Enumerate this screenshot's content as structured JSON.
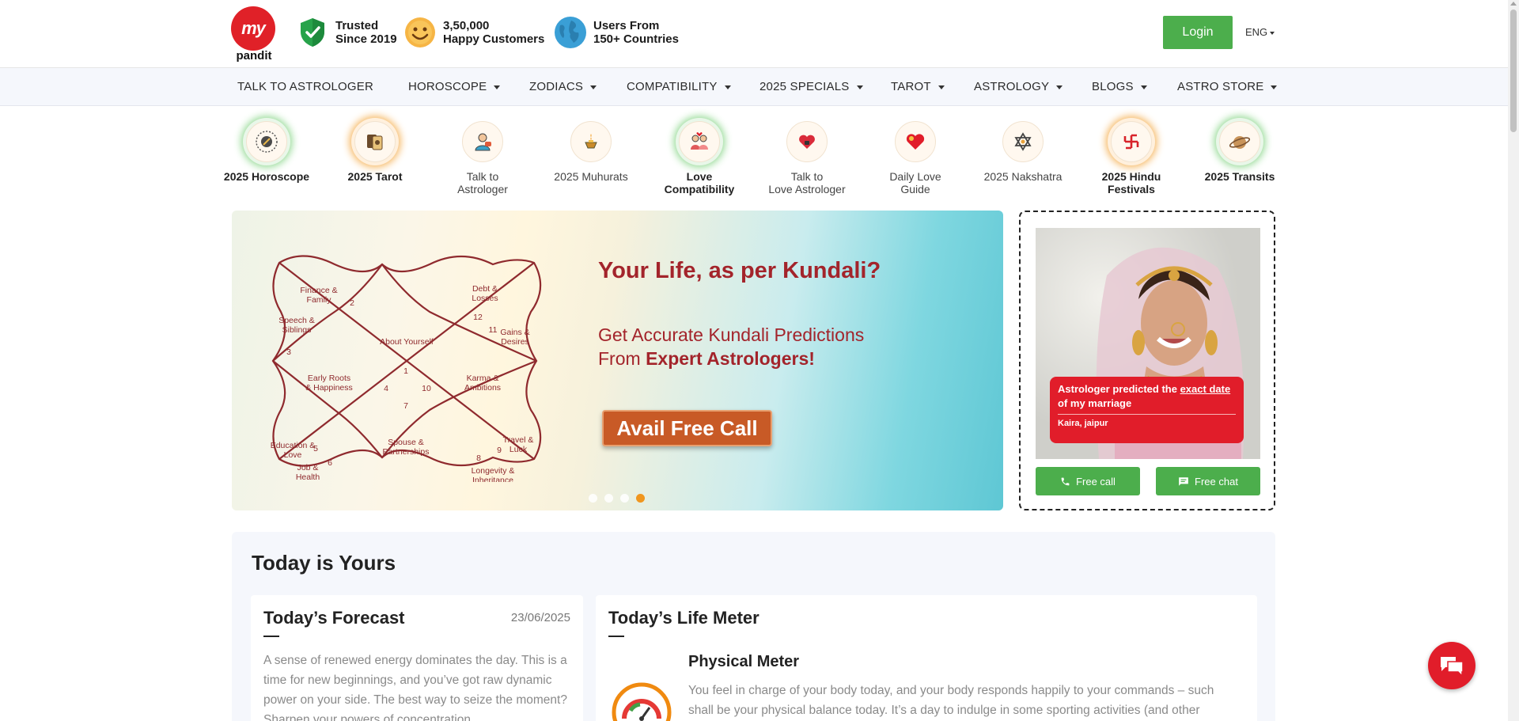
{
  "header": {
    "logo_my": "my",
    "logo_text": "pandit",
    "trust_items": [
      {
        "icon": "shield-check-icon",
        "line1": "Trusted",
        "line2": "Since 2019"
      },
      {
        "icon": "smiley-icon",
        "line1": "3,50,000",
        "line2": "Happy Customers"
      },
      {
        "icon": "globe-icon",
        "line1": "Users From",
        "line2": "150+ Countries"
      }
    ],
    "login_label": "Login",
    "language": "ENG"
  },
  "nav": {
    "items": [
      {
        "label": "TALK TO ASTROLOGER",
        "dropdown": false
      },
      {
        "label": "HOROSCOPE",
        "dropdown": true
      },
      {
        "label": "ZODIACS",
        "dropdown": true
      },
      {
        "label": "COMPATIBILITY",
        "dropdown": true
      },
      {
        "label": "2025 SPECIALS",
        "dropdown": true
      },
      {
        "label": "TAROT",
        "dropdown": true
      },
      {
        "label": "ASTROLOGY",
        "dropdown": true
      },
      {
        "label": "BLOGS",
        "dropdown": true
      },
      {
        "label": "ASTRO STORE",
        "dropdown": true
      }
    ]
  },
  "quick_links": [
    {
      "label": "2025 Horoscope",
      "icon": "horoscope-wheel-icon",
      "bold": true,
      "glow": "green"
    },
    {
      "label": "2025 Tarot",
      "icon": "tarot-cards-icon",
      "bold": true,
      "glow": "orange"
    },
    {
      "label": "Talk to Astrologer",
      "icon": "astrologer-icon",
      "bold": false,
      "glow": ""
    },
    {
      "label": "2025 Muhurats",
      "icon": "muhurat-lamp-icon",
      "bold": false,
      "glow": ""
    },
    {
      "label": "Love Compatibility",
      "icon": "couple-icon",
      "bold": true,
      "glow": "green"
    },
    {
      "label": "Talk to Love Astrologer",
      "icon": "heart-lock-icon",
      "bold": false,
      "glow": ""
    },
    {
      "label": "Daily Love Guide",
      "icon": "heart-icon",
      "bold": false,
      "glow": ""
    },
    {
      "label": "2025 Nakshatra",
      "icon": "star-of-david-icon",
      "bold": false,
      "glow": ""
    },
    {
      "label": "2025 Hindu Festivals",
      "icon": "swastika-icon",
      "bold": true,
      "glow": "orange"
    },
    {
      "label": "2025 Transits",
      "icon": "planet-transit-icon",
      "bold": true,
      "glow": "green"
    }
  ],
  "banner": {
    "title": "Your Life, as per Kundali?",
    "subtitle_line1": "Get Accurate Kundali Predictions",
    "subtitle_line2_pre": "From ",
    "subtitle_line2_bold": "Expert Astrologers!",
    "cta": "Avail Free Call",
    "slide_count": 4,
    "active_slide": 4,
    "kundli_labels": [
      "Finance & Family",
      "2",
      "Debt & Losses",
      "12",
      "Speech & Siblings",
      "11",
      "Gains & Desires",
      "3",
      "About Yourself",
      "1",
      "Early Roots & Happiness",
      "4",
      "10",
      "Karma & Ambitions",
      "7",
      "Education & Love",
      "5",
      "Spouse & Partnerships",
      "9",
      "Travel & Luck",
      "6",
      "8",
      "Job & Health",
      "Longevity & Inheritance"
    ]
  },
  "testimonial": {
    "quote_pre": "Astrologer predicted the ",
    "quote_underlined": "exact date",
    "quote_post": " of my marriage",
    "author": "Kaira, jaipur",
    "call_label": "Free call",
    "chat_label": "Free chat"
  },
  "today": {
    "title": "Today is Yours",
    "forecast": {
      "title": "Today’s Forecast",
      "date": "23/06/2025",
      "text": "A sense of renewed energy dominates the day. This is a time for new beginnings, and you’ve got raw dynamic power on your side. The best way to seize the moment? Sharpen your powers of concentration."
    },
    "life_meter": {
      "title": "Today’s Life Meter",
      "meter_title": "Physical Meter",
      "meter_text": "You feel in charge of your body today, and your body responds happily to your commands – such shall be your physical balance today. It’s a day to indulge in some sporting activities (and other"
    }
  },
  "colors": {
    "brand_red": "#e02128",
    "green": "#4cae4c",
    "banner_text": "#a3242b",
    "cta_orange": "#c85a26"
  }
}
